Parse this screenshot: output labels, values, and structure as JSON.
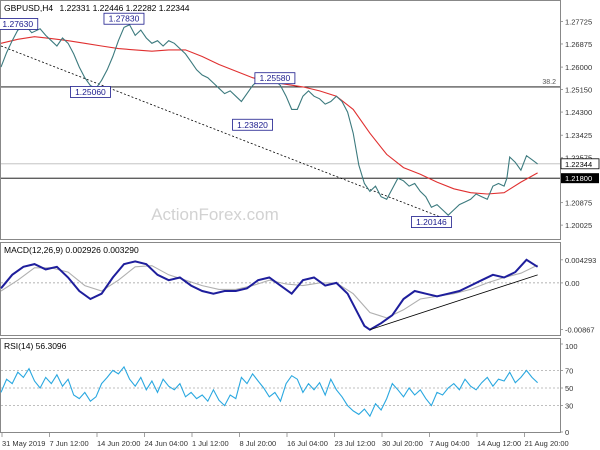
{
  "chart_data": {
    "type": "line",
    "symbol": "GBPUSD,H4",
    "ohlc_text": "1.22331 1.22446 1.22282 1.22344",
    "watermark": "ActionForex.com",
    "x_labels": [
      "31 May 2019",
      "7 Jun 12:00",
      "14 Jun 20:00",
      "24 Jun 04:00",
      "1 Jul 12:00",
      "8 Jul 20:00",
      "16 Jul 04:00",
      "23 Jul 12:00",
      "30 Jul 20:00",
      "7 Aug 04:00",
      "14 Aug 12:00",
      "21 Aug 20:00"
    ],
    "colors": {
      "price": "#3c7a7e",
      "ma": "#e03030",
      "macd": "#1e1e9c",
      "signal": "#b0b0b0",
      "rsi": "#2aa8e0",
      "label_box": "#1a1a8c"
    },
    "price_panel": {
      "ylim": [
        1.195,
        1.285
      ],
      "y_ticks": [
        "1.27725",
        "1.26875",
        "1.26000",
        "1.25150",
        "1.24300",
        "1.23425",
        "1.22575",
        "1.21800",
        "1.20875",
        "1.20025"
      ],
      "y_tick_values": [
        1.27725,
        1.26875,
        1.26,
        1.2515,
        1.243,
        1.23425,
        1.22575,
        1.218,
        1.20875,
        1.20025
      ],
      "current_price": "1.22344",
      "current_value": 1.22344,
      "fib_label": "38.2",
      "fib_level": 1.2525,
      "support_level_label": "1.21800",
      "support_level": 1.218,
      "annotations": [
        {
          "text": "1.27630",
          "x": 0.03,
          "y": 1.2763
        },
        {
          "text": "1.27830",
          "x": 0.22,
          "y": 1.2783
        },
        {
          "text": "1.25060",
          "x": 0.16,
          "y": 1.2506
        },
        {
          "text": "1.25580",
          "x": 0.49,
          "y": 1.2558
        },
        {
          "text": "1.23820",
          "x": 0.45,
          "y": 1.2382
        },
        {
          "text": "1.20146",
          "x": 0.77,
          "y": 1.2014
        }
      ],
      "trendline": {
        "from": [
          0.0,
          1.268
        ],
        "to": [
          0.79,
          1.203
        ]
      },
      "close": [
        [
          0.0,
          1.26
        ],
        [
          0.01,
          1.2655
        ],
        [
          0.02,
          1.27
        ],
        [
          0.03,
          1.274
        ],
        [
          0.045,
          1.2755
        ],
        [
          0.055,
          1.273
        ],
        [
          0.07,
          1.2745
        ],
        [
          0.08,
          1.272
        ],
        [
          0.09,
          1.27
        ],
        [
          0.1,
          1.268
        ],
        [
          0.11,
          1.271
        ],
        [
          0.12,
          1.269
        ],
        [
          0.13,
          1.265
        ],
        [
          0.14,
          1.26
        ],
        [
          0.15,
          1.256
        ],
        [
          0.16,
          1.253
        ],
        [
          0.17,
          1.252
        ],
        [
          0.18,
          1.255
        ],
        [
          0.19,
          1.259
        ],
        [
          0.2,
          1.264
        ],
        [
          0.21,
          1.27
        ],
        [
          0.22,
          1.275
        ],
        [
          0.23,
          1.276
        ],
        [
          0.24,
          1.272
        ],
        [
          0.25,
          1.274
        ],
        [
          0.26,
          1.271
        ],
        [
          0.27,
          1.269
        ],
        [
          0.28,
          1.27
        ],
        [
          0.29,
          1.268
        ],
        [
          0.3,
          1.27
        ],
        [
          0.31,
          1.269
        ],
        [
          0.32,
          1.267
        ],
        [
          0.33,
          1.265
        ],
        [
          0.34,
          1.262
        ],
        [
          0.35,
          1.259
        ],
        [
          0.36,
          1.257
        ],
        [
          0.37,
          1.256
        ],
        [
          0.38,
          1.254
        ],
        [
          0.39,
          1.252
        ],
        [
          0.4,
          1.25
        ],
        [
          0.41,
          1.251
        ],
        [
          0.42,
          1.249
        ],
        [
          0.43,
          1.247
        ],
        [
          0.44,
          1.25
        ],
        [
          0.45,
          1.253
        ],
        [
          0.46,
          1.255
        ],
        [
          0.47,
          1.254
        ],
        [
          0.48,
          1.256
        ],
        [
          0.49,
          1.255
        ],
        [
          0.5,
          1.253
        ],
        [
          0.51,
          1.249
        ],
        [
          0.52,
          1.244
        ],
        [
          0.53,
          1.244
        ],
        [
          0.54,
          1.249
        ],
        [
          0.55,
          1.251
        ],
        [
          0.56,
          1.249
        ],
        [
          0.57,
          1.248
        ],
        [
          0.58,
          1.246
        ],
        [
          0.59,
          1.247
        ],
        [
          0.6,
          1.249
        ],
        [
          0.61,
          1.247
        ],
        [
          0.62,
          1.243
        ],
        [
          0.63,
          1.235
        ],
        [
          0.64,
          1.223
        ],
        [
          0.65,
          1.216
        ],
        [
          0.66,
          1.213
        ],
        [
          0.67,
          1.215
        ],
        [
          0.68,
          1.211
        ],
        [
          0.69,
          1.21
        ],
        [
          0.7,
          1.214
        ],
        [
          0.71,
          1.218
        ],
        [
          0.72,
          1.217
        ],
        [
          0.73,
          1.215
        ],
        [
          0.74,
          1.216
        ],
        [
          0.75,
          1.213
        ],
        [
          0.76,
          1.211
        ],
        [
          0.77,
          1.207
        ],
        [
          0.78,
          1.208
        ],
        [
          0.79,
          1.206
        ],
        [
          0.8,
          1.204
        ],
        [
          0.81,
          1.206
        ],
        [
          0.82,
          1.208
        ],
        [
          0.83,
          1.209
        ],
        [
          0.84,
          1.21
        ],
        [
          0.85,
          1.212
        ],
        [
          0.86,
          1.211
        ],
        [
          0.87,
          1.21
        ],
        [
          0.88,
          1.215
        ],
        [
          0.89,
          1.216
        ],
        [
          0.9,
          1.215
        ],
        [
          0.905,
          1.218
        ],
        [
          0.91,
          1.226
        ],
        [
          0.92,
          1.224
        ],
        [
          0.93,
          1.221
        ],
        [
          0.94,
          1.2265
        ],
        [
          0.95,
          1.225
        ],
        [
          0.96,
          1.2234
        ]
      ],
      "ma": [
        [
          0.0,
          1.269
        ],
        [
          0.03,
          1.2705
        ],
        [
          0.06,
          1.2715
        ],
        [
          0.09,
          1.2708
        ],
        [
          0.12,
          1.27
        ],
        [
          0.15,
          1.269
        ],
        [
          0.18,
          1.268
        ],
        [
          0.21,
          1.267
        ],
        [
          0.24,
          1.2665
        ],
        [
          0.27,
          1.266
        ],
        [
          0.3,
          1.2665
        ],
        [
          0.33,
          1.2665
        ],
        [
          0.36,
          1.264
        ],
        [
          0.39,
          1.261
        ],
        [
          0.42,
          1.2585
        ],
        [
          0.45,
          1.256
        ],
        [
          0.48,
          1.2545
        ],
        [
          0.51,
          1.2535
        ],
        [
          0.54,
          1.2525
        ],
        [
          0.57,
          1.251
        ],
        [
          0.6,
          1.249
        ],
        [
          0.63,
          1.244
        ],
        [
          0.66,
          1.235
        ],
        [
          0.69,
          1.227
        ],
        [
          0.72,
          1.222
        ],
        [
          0.75,
          1.2195
        ],
        [
          0.78,
          1.2165
        ],
        [
          0.81,
          1.214
        ],
        [
          0.84,
          1.2125
        ],
        [
          0.87,
          1.212
        ],
        [
          0.9,
          1.2125
        ],
        [
          0.93,
          1.2165
        ],
        [
          0.96,
          1.22
        ]
      ]
    },
    "macd_panel": {
      "label": "MACD(12,26,9) 0.002926 0.003290",
      "ylim": [
        -0.0095,
        0.005
      ],
      "y_ticks": [
        "0.004293",
        "0.00",
        "-0.00867"
      ],
      "y_tick_values": [
        0.004293,
        0.0,
        -0.00867
      ],
      "macd": [
        [
          0.0,
          -0.001
        ],
        [
          0.02,
          0.0015
        ],
        [
          0.04,
          0.003
        ],
        [
          0.06,
          0.0035
        ],
        [
          0.08,
          0.0025
        ],
        [
          0.1,
          0.003
        ],
        [
          0.12,
          0.001
        ],
        [
          0.14,
          -0.0015
        ],
        [
          0.16,
          -0.003
        ],
        [
          0.18,
          -0.002
        ],
        [
          0.2,
          0.001
        ],
        [
          0.22,
          0.0035
        ],
        [
          0.24,
          0.004
        ],
        [
          0.26,
          0.0035
        ],
        [
          0.28,
          0.0015
        ],
        [
          0.3,
          0.0005
        ],
        [
          0.32,
          0.001
        ],
        [
          0.34,
          -0.0005
        ],
        [
          0.36,
          -0.0015
        ],
        [
          0.38,
          -0.002
        ],
        [
          0.4,
          -0.0015
        ],
        [
          0.42,
          -0.0015
        ],
        [
          0.44,
          -0.001
        ],
        [
          0.46,
          0.0005
        ],
        [
          0.48,
          0.001
        ],
        [
          0.5,
          -0.0005
        ],
        [
          0.52,
          -0.002
        ],
        [
          0.54,
          0.0005
        ],
        [
          0.56,
          0.001
        ],
        [
          0.58,
          -0.0005
        ],
        [
          0.6,
          0.0
        ],
        [
          0.62,
          -0.002
        ],
        [
          0.64,
          -0.006
        ],
        [
          0.65,
          -0.008
        ],
        [
          0.66,
          -0.0087
        ],
        [
          0.68,
          -0.0075
        ],
        [
          0.7,
          -0.006
        ],
        [
          0.72,
          -0.003
        ],
        [
          0.74,
          -0.0015
        ],
        [
          0.76,
          -0.002
        ],
        [
          0.78,
          -0.0025
        ],
        [
          0.8,
          -0.002
        ],
        [
          0.82,
          -0.0015
        ],
        [
          0.84,
          -0.0005
        ],
        [
          0.86,
          0.0005
        ],
        [
          0.88,
          0.0015
        ],
        [
          0.9,
          0.001
        ],
        [
          0.92,
          0.002
        ],
        [
          0.94,
          0.0043
        ],
        [
          0.96,
          0.003
        ]
      ],
      "signal": [
        [
          0.0,
          -0.0015
        ],
        [
          0.03,
          0.0005
        ],
        [
          0.06,
          0.0028
        ],
        [
          0.09,
          0.0028
        ],
        [
          0.12,
          0.002
        ],
        [
          0.15,
          -0.0005
        ],
        [
          0.18,
          -0.0015
        ],
        [
          0.21,
          0.0005
        ],
        [
          0.24,
          0.003
        ],
        [
          0.27,
          0.0032
        ],
        [
          0.3,
          0.0015
        ],
        [
          0.33,
          0.0005
        ],
        [
          0.36,
          -0.0005
        ],
        [
          0.39,
          -0.0012
        ],
        [
          0.42,
          -0.0012
        ],
        [
          0.45,
          -0.0005
        ],
        [
          0.48,
          0.0005
        ],
        [
          0.51,
          -0.0002
        ],
        [
          0.54,
          -0.0005
        ],
        [
          0.57,
          0.0
        ],
        [
          0.6,
          0.0
        ],
        [
          0.63,
          -0.002
        ],
        [
          0.66,
          -0.0055
        ],
        [
          0.69,
          -0.0065
        ],
        [
          0.72,
          -0.005
        ],
        [
          0.75,
          -0.003
        ],
        [
          0.78,
          -0.0025
        ],
        [
          0.81,
          -0.002
        ],
        [
          0.84,
          -0.0012
        ],
        [
          0.87,
          0.0
        ],
        [
          0.9,
          0.001
        ],
        [
          0.93,
          0.0018
        ],
        [
          0.96,
          0.0033
        ]
      ],
      "trendline": {
        "from": [
          0.66,
          -0.0087
        ],
        "to": [
          0.96,
          0.0015
        ]
      }
    },
    "rsi_panel": {
      "label": "RSI(14) 56.3096",
      "ylim": [
        0,
        100
      ],
      "y_ticks": [
        "100",
        "70",
        "50",
        "30",
        "0"
      ],
      "y_tick_values": [
        100,
        70,
        50,
        30,
        0
      ],
      "rsi": [
        [
          0.0,
          45
        ],
        [
          0.01,
          60
        ],
        [
          0.02,
          55
        ],
        [
          0.03,
          68
        ],
        [
          0.04,
          62
        ],
        [
          0.05,
          72
        ],
        [
          0.06,
          58
        ],
        [
          0.07,
          50
        ],
        [
          0.08,
          62
        ],
        [
          0.09,
          55
        ],
        [
          0.1,
          65
        ],
        [
          0.11,
          52
        ],
        [
          0.12,
          60
        ],
        [
          0.13,
          42
        ],
        [
          0.14,
          38
        ],
        [
          0.15,
          45
        ],
        [
          0.16,
          35
        ],
        [
          0.17,
          40
        ],
        [
          0.18,
          55
        ],
        [
          0.19,
          62
        ],
        [
          0.2,
          70
        ],
        [
          0.21,
          66
        ],
        [
          0.22,
          74
        ],
        [
          0.23,
          60
        ],
        [
          0.24,
          52
        ],
        [
          0.25,
          62
        ],
        [
          0.26,
          48
        ],
        [
          0.27,
          58
        ],
        [
          0.28,
          45
        ],
        [
          0.29,
          60
        ],
        [
          0.3,
          52
        ],
        [
          0.31,
          48
        ],
        [
          0.32,
          55
        ],
        [
          0.33,
          40
        ],
        [
          0.34,
          45
        ],
        [
          0.35,
          38
        ],
        [
          0.36,
          42
        ],
        [
          0.37,
          35
        ],
        [
          0.38,
          48
        ],
        [
          0.39,
          36
        ],
        [
          0.4,
          30
        ],
        [
          0.41,
          42
        ],
        [
          0.42,
          38
        ],
        [
          0.43,
          62
        ],
        [
          0.44,
          55
        ],
        [
          0.45,
          66
        ],
        [
          0.46,
          58
        ],
        [
          0.47,
          50
        ],
        [
          0.48,
          40
        ],
        [
          0.49,
          45
        ],
        [
          0.5,
          35
        ],
        [
          0.51,
          55
        ],
        [
          0.52,
          64
        ],
        [
          0.53,
          60
        ],
        [
          0.54,
          45
        ],
        [
          0.55,
          55
        ],
        [
          0.56,
          48
        ],
        [
          0.57,
          56
        ],
        [
          0.58,
          42
        ],
        [
          0.59,
          60
        ],
        [
          0.6,
          48
        ],
        [
          0.61,
          40
        ],
        [
          0.62,
          30
        ],
        [
          0.63,
          24
        ],
        [
          0.64,
          20
        ],
        [
          0.65,
          26
        ],
        [
          0.66,
          18
        ],
        [
          0.67,
          32
        ],
        [
          0.68,
          25
        ],
        [
          0.69,
          38
        ],
        [
          0.7,
          55
        ],
        [
          0.71,
          48
        ],
        [
          0.72,
          40
        ],
        [
          0.73,
          50
        ],
        [
          0.74,
          42
        ],
        [
          0.75,
          48
        ],
        [
          0.76,
          38
        ],
        [
          0.77,
          30
        ],
        [
          0.78,
          45
        ],
        [
          0.79,
          42
        ],
        [
          0.8,
          50
        ],
        [
          0.81,
          55
        ],
        [
          0.82,
          48
        ],
        [
          0.83,
          60
        ],
        [
          0.84,
          52
        ],
        [
          0.85,
          48
        ],
        [
          0.86,
          56
        ],
        [
          0.87,
          62
        ],
        [
          0.88,
          52
        ],
        [
          0.89,
          60
        ],
        [
          0.9,
          58
        ],
        [
          0.91,
          68
        ],
        [
          0.92,
          56
        ],
        [
          0.93,
          62
        ],
        [
          0.94,
          70
        ],
        [
          0.95,
          62
        ],
        [
          0.96,
          56
        ]
      ]
    }
  }
}
